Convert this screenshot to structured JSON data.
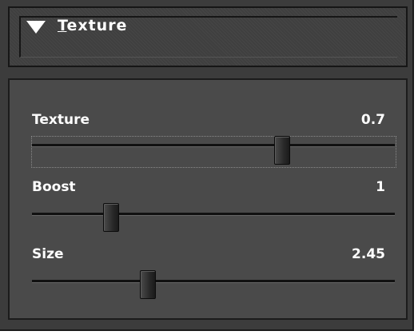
{
  "section": {
    "title_first": "T",
    "title_rest": "exture",
    "expanded": true
  },
  "sliders": [
    {
      "label": "Texture",
      "value": "0.7"
    },
    {
      "label": "Boost",
      "value": "1"
    },
    {
      "label": "Size",
      "value": "2.45"
    }
  ],
  "colors": {
    "panel": "#3c3c3c",
    "content": "#4a4a4a",
    "text": "#ffffff",
    "track": "#111111"
  },
  "icons": {
    "disclosure": "disclosure-triangle-down-icon"
  }
}
